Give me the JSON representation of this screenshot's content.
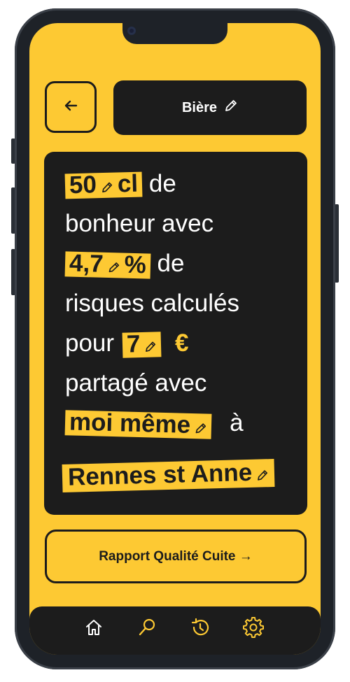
{
  "header": {
    "back_icon": "arrow-left-icon",
    "title": "Bière",
    "edit_icon": "pencil-icon"
  },
  "card": {
    "volume_value": "50",
    "volume_unit": "cl",
    "text_1": " de",
    "text_2": "bonheur avec",
    "abv_value": "4,7",
    "abv_unit": "%",
    "text_3": " de",
    "text_4": "risques calculés",
    "text_5": "pour",
    "price_value": "7",
    "price_unit": "€",
    "text_6": "partagé avec",
    "shared_with": "moi même",
    "text_7": "à",
    "location": "Rennes st Anne"
  },
  "cta": {
    "label": "Rapport Qualité Cuite →"
  },
  "nav": {
    "items": [
      {
        "icon": "home-icon"
      },
      {
        "icon": "search-icon"
      },
      {
        "icon": "history-icon"
      },
      {
        "icon": "settings-icon"
      }
    ]
  },
  "colors": {
    "accent": "#fdc933",
    "dark": "#1c1c1c",
    "text_light": "#ffffff"
  }
}
